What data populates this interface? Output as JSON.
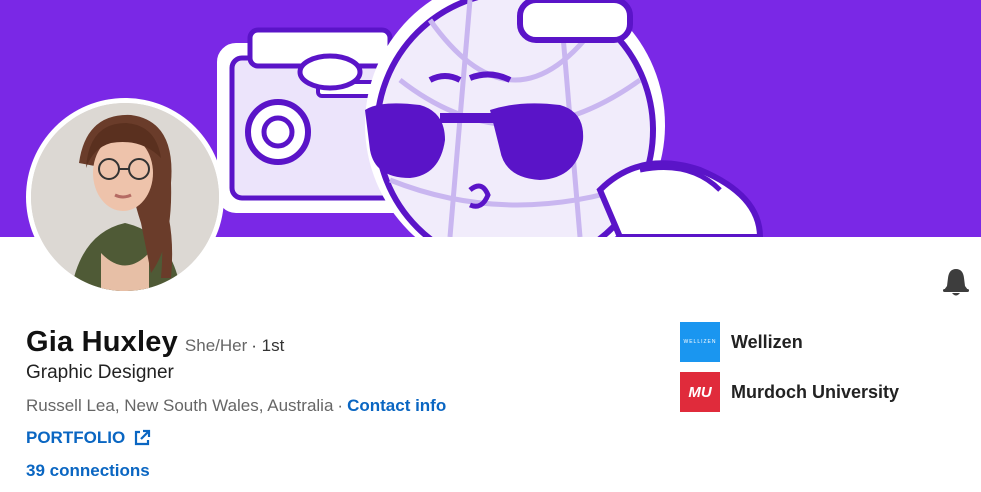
{
  "banner": {
    "background": "#7a28e6"
  },
  "profile": {
    "name": "Gia Huxley",
    "pronouns": "She/Her",
    "degree": "· 1st",
    "headline": "Graphic Designer",
    "location": "Russell Lea, New South Wales, Australia",
    "separator": "·",
    "contact_info_label": "Contact info",
    "portfolio_label": "PORTFOLIO",
    "connections_label": "39 connections"
  },
  "organizations": [
    {
      "name": "Wellizen",
      "logo_text": "WELLIZEN",
      "color": "#1a96f0"
    },
    {
      "name": "Murdoch University",
      "logo_text": "MU",
      "color": "#e02b3b"
    }
  ],
  "colors": {
    "link": "#0a66c2",
    "accent": "#7a28e6"
  }
}
